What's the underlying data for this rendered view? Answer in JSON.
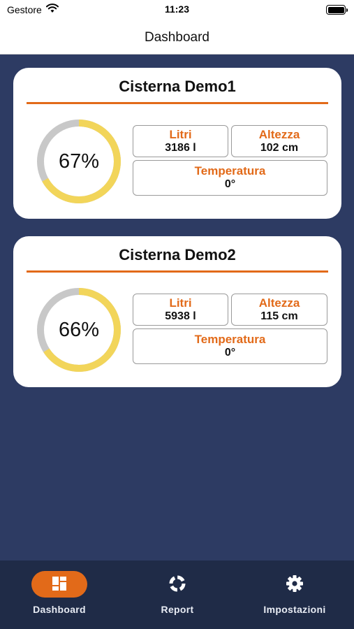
{
  "status_bar": {
    "carrier": "Gestore",
    "time": "11:23"
  },
  "nav": {
    "title": "Dashboard"
  },
  "cisterns": [
    {
      "name": "Cisterna Demo1",
      "percent_label": "67%",
      "fill_fraction": 0.67,
      "litri_label": "Litri",
      "litri_value": "3186 l",
      "altezza_label": "Altezza",
      "altezza_value": "102 cm",
      "temperatura_label": "Temperatura",
      "temperatura_value": "0°"
    },
    {
      "name": "Cisterna Demo2",
      "percent_label": "66%",
      "fill_fraction": 0.66,
      "litri_label": "Litri",
      "litri_value": "5938 l",
      "altezza_label": "Altezza",
      "altezza_value": "115 cm",
      "temperatura_label": "Temperatura",
      "temperatura_value": "0°"
    }
  ],
  "tabs": [
    {
      "label": "Dashboard",
      "icon": "dashboard-grid-icon",
      "active": true
    },
    {
      "label": "Report",
      "icon": "report-donut-icon",
      "active": false
    },
    {
      "label": "Impostazioni",
      "icon": "gear-icon",
      "active": false
    }
  ],
  "colors": {
    "accent": "#e26a19",
    "gauge_fill": "#f2d55a",
    "gauge_track": "#c8c8c8",
    "background": "#2d3b63",
    "tab_bar": "#1f2b47"
  }
}
